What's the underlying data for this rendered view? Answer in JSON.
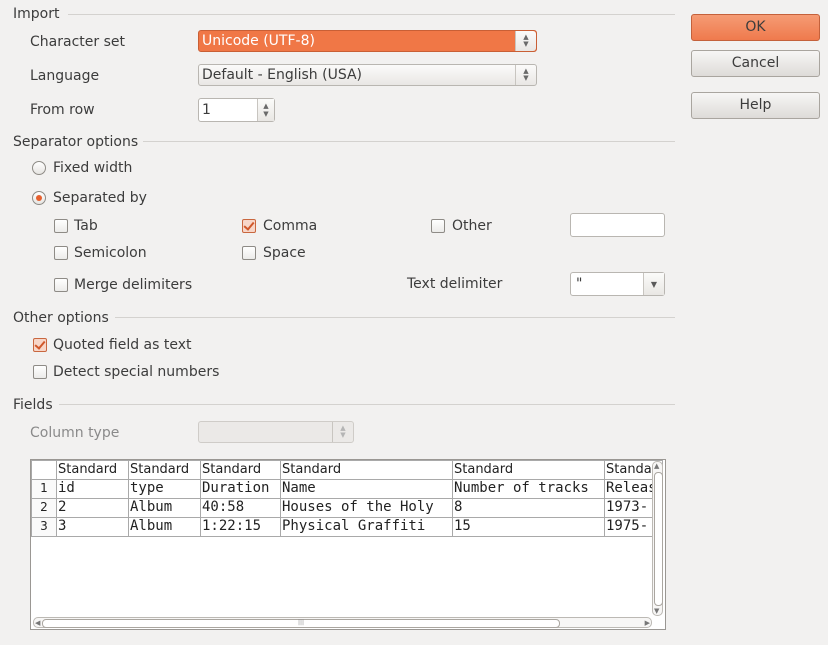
{
  "import": {
    "title": "Import",
    "charset_label": "Character set",
    "charset_value": "Unicode (UTF-8)",
    "language_label": "Language",
    "language_value": "Default - English (USA)",
    "from_row_label": "From row",
    "from_row_value": "1"
  },
  "buttons": {
    "ok": "OK",
    "cancel": "Cancel",
    "help": "Help"
  },
  "separator": {
    "title": "Separator options",
    "fixed_width": "Fixed width",
    "separated_by": "Separated by",
    "tab": "Tab",
    "comma": "Comma",
    "other": "Other",
    "semicolon": "Semicolon",
    "space": "Space",
    "merge": "Merge delimiters",
    "text_delimiter_label": "Text delimiter",
    "text_delimiter_value": "\""
  },
  "other_options": {
    "title": "Other options",
    "quoted_field": "Quoted field as text",
    "detect_special": "Detect special numbers"
  },
  "fields": {
    "title": "Fields",
    "column_type_label": "Column type",
    "column_type_value": "",
    "header": [
      "Standard",
      "Standard",
      "Standard",
      "Standard",
      "Standard",
      "Standa"
    ],
    "rows": [
      {
        "num": "1",
        "cells": [
          "id",
          "type",
          "Duration",
          "Name",
          "Number of tracks",
          "Releas"
        ]
      },
      {
        "num": "2",
        "cells": [
          "2",
          "Album",
          "40:58",
          "Houses of the Holy",
          "8",
          "1973-"
        ]
      },
      {
        "num": "3",
        "cells": [
          "3",
          "Album",
          "1:22:15",
          "Physical Graffiti",
          "15",
          "1975-"
        ]
      }
    ]
  },
  "colors": {
    "accent": "#f07746",
    "background": "#f2f1f0"
  }
}
